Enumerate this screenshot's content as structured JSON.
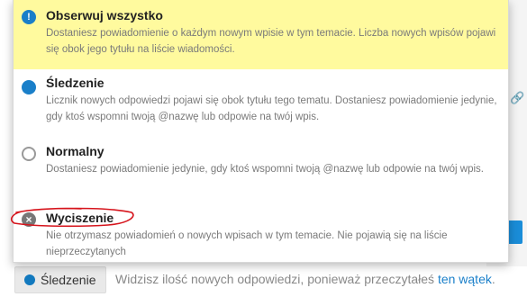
{
  "background": {
    "footer_button_label": "Śledzenie",
    "footer_text": "Widzisz ilość nowych odpowiedzi, ponieważ przeczytałeś",
    "footer_link": "ten wątek",
    "footer_end": "."
  },
  "dropdown": {
    "options": [
      {
        "title": "Obserwuj wszystko",
        "description": "Dostaniesz powiadomienie o każdym nowym wpisie w tym temacie. Liczba nowych wpisów pojawi się obok jego tytułu na liście wiadomości.",
        "icon": "exclamation-icon",
        "highlighted": true
      },
      {
        "title": "Śledzenie",
        "description": "Licznik nowych odpowiedzi pojawi się obok tytułu tego tematu. Dostaniesz powiadomienie jedynie, gdy ktoś wspomni twoją @nazwę lub odpowie na twój wpis.",
        "icon": "filled-circle-icon"
      },
      {
        "title": "Normalny",
        "description": "Dostaniesz powiadomienie jedynie, gdy ktoś wspomni twoją @nazwę lub odpowie na twój wpis.",
        "icon": "empty-circle-icon"
      },
      {
        "title": "Wyciszenie",
        "description": "Nie otrzymasz powiadomień o nowych wpisach w tym temacie. Nie pojawią się na liście nieprzeczytanych",
        "icon": "mute-x-icon"
      }
    ]
  },
  "colors": {
    "highlight": "#fffa9e",
    "accent_blue": "#1a7fc9",
    "annotation_red": "#d6141c"
  }
}
